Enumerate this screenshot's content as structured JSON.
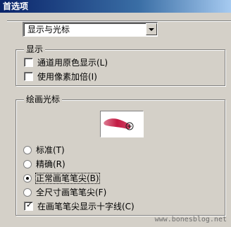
{
  "window": {
    "title": "首选项"
  },
  "dropdown": {
    "value": "显示与光标"
  },
  "display_group": {
    "legend": "显示",
    "items": [
      {
        "label": "通道用原色显示(L)",
        "checked": false
      },
      {
        "label": "使用像素加倍(I)",
        "checked": false
      }
    ]
  },
  "cursor_group": {
    "legend": "绘画光标",
    "options": [
      {
        "label": "标准(T)",
        "selected": false
      },
      {
        "label": "精确(R)",
        "selected": false
      },
      {
        "label": "正常画笔笔尖(B)",
        "selected": true
      },
      {
        "label": "全尺寸画笔笔尖(F)",
        "selected": false
      }
    ],
    "crosshair": {
      "label": "在画笔笔尖显示十字线(C)",
      "checked": true
    }
  },
  "watermark": "www.bonesblog.net",
  "colors": {
    "brush_stroke": "#c0103a",
    "titlebar": "#0a246a"
  }
}
